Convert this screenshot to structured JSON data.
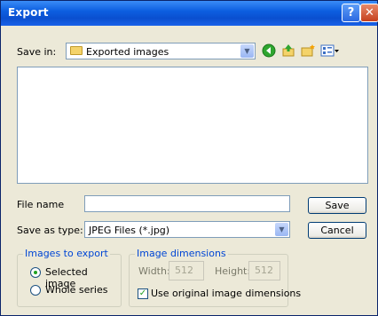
{
  "window": {
    "title": "Export",
    "help_glyph": "?",
    "close_glyph": "✕"
  },
  "save_in": {
    "label": "Save in:",
    "value": "Exported images"
  },
  "toolbar": {
    "icons": [
      "back-icon",
      "up-folder-icon",
      "new-folder-icon",
      "views-menu-icon"
    ]
  },
  "file_name": {
    "label": "File name",
    "value": ""
  },
  "save_as_type": {
    "label": "Save as type:",
    "value": "JPEG Files (*.jpg)"
  },
  "buttons": {
    "save": "Save",
    "cancel": "Cancel"
  },
  "images_to_export": {
    "legend": "Images to export",
    "options": [
      "Selected image",
      "Whole series"
    ],
    "selected": "Selected image"
  },
  "image_dimensions": {
    "legend": "Image dimensions",
    "width_label": "Width:",
    "width_value": "512",
    "height_label": "Height:",
    "height_value": "512",
    "use_original_label": "Use original image dimensions",
    "use_original_checked": true
  },
  "colors": {
    "titlebar": "#0a4fd0",
    "dialog_bg": "#ece9d8",
    "accent_green": "#21a121",
    "legend_blue": "#0046d5"
  }
}
